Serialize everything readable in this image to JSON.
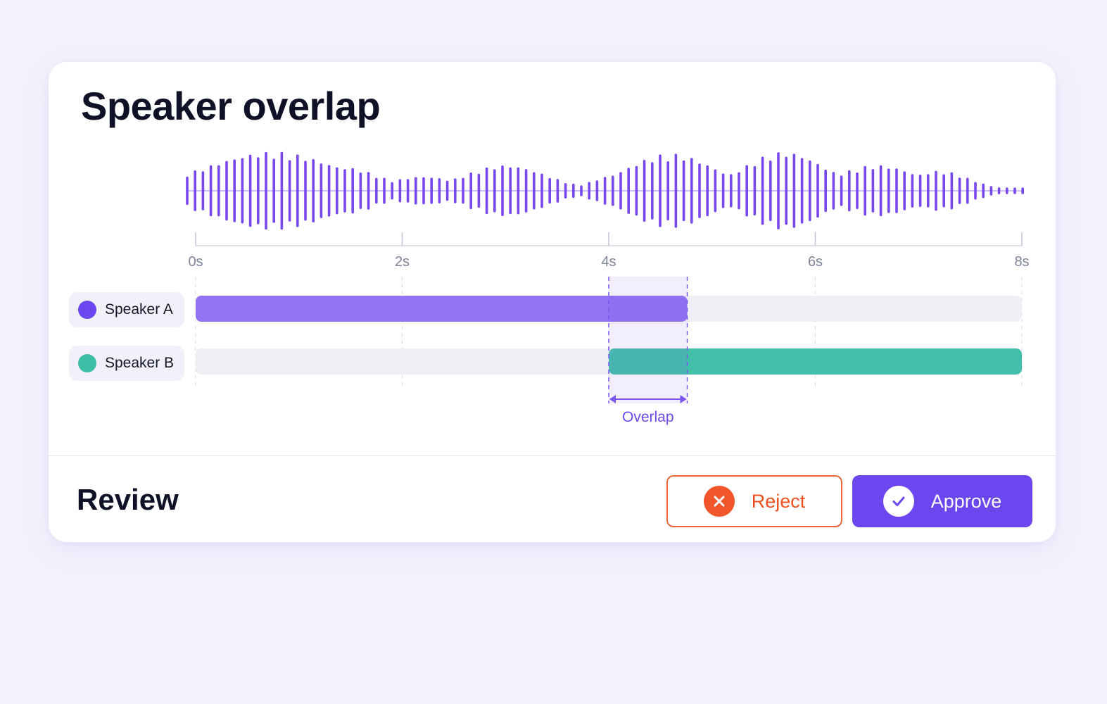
{
  "title": "Speaker overlap",
  "timeline": {
    "ticks": [
      "0s",
      "2s",
      "4s",
      "6s",
      "8s"
    ],
    "duration_s": 8,
    "overlap_label": "Overlap",
    "overlap_range_s": [
      4.0,
      4.76
    ]
  },
  "speakers": [
    {
      "label": "Speaker A",
      "color": "#6c47f0",
      "bar_color": "#9173f4",
      "segment_s": [
        0,
        4.76
      ]
    },
    {
      "label": "Speaker B",
      "color": "#3dbfa8",
      "bar_color": "#42c0aa",
      "segment_s": [
        4.0,
        8.0
      ]
    }
  ],
  "waveform_color": "#7747ef",
  "review": {
    "label": "Review",
    "reject_label": "Reject",
    "approve_label": "Approve"
  },
  "colors": {
    "accent": "#6c47f0",
    "reject": "#f2552a",
    "overlap": "#7b56f0"
  }
}
